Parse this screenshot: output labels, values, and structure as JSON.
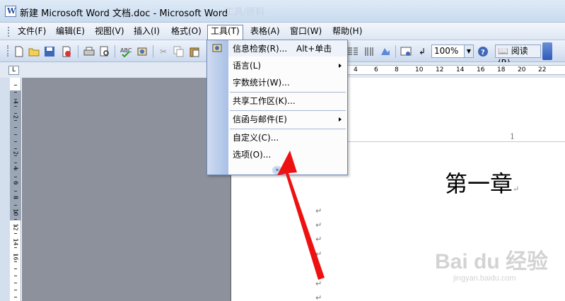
{
  "window": {
    "title": "新建 Microsoft Word 文档.doc - Microsoft Word",
    "ghost_text": "工具/原料"
  },
  "menubar": {
    "items": [
      "文件(F)",
      "编辑(E)",
      "视图(V)",
      "插入(I)",
      "格式(O)",
      "工具(T)",
      "表格(A)",
      "窗口(W)",
      "帮助(H)"
    ],
    "active": "工具(T)"
  },
  "toolbar": {
    "zoom": "100%",
    "read_label": "阅读(R)"
  },
  "tools_menu": {
    "items": [
      {
        "label": "信息检索(R)...",
        "shortcut": "Alt+单击",
        "icon": "research-icon"
      },
      {
        "label": "语言(L)",
        "submenu": true
      },
      {
        "label": "字数统计(W)..."
      },
      {
        "label": "共享工作区(K)..."
      },
      {
        "label": "信函与邮件(E)",
        "submenu": true
      },
      {
        "label": "自定义(C)..."
      },
      {
        "label": "选项(O)..."
      }
    ],
    "expand_glyph": "»"
  },
  "document": {
    "page_number": "1",
    "heading": "第一章",
    "para_mark": "↵"
  },
  "rulers": {
    "horizontal_ticks": [
      "4",
      "6",
      "8",
      "10",
      "12",
      "14",
      "16",
      "18",
      "20",
      "22"
    ],
    "vertical_ticks": [
      "4",
      "2",
      "2",
      "4",
      "6",
      "8",
      "10",
      "12",
      "14",
      "16"
    ]
  },
  "watermark": {
    "brand": "Bai du 经验",
    "url": "jingyan.baidu.com"
  },
  "colors": {
    "menu_highlight": "#6d87b3",
    "arrow": "#ee1111",
    "page_bg": "#8c919b"
  }
}
